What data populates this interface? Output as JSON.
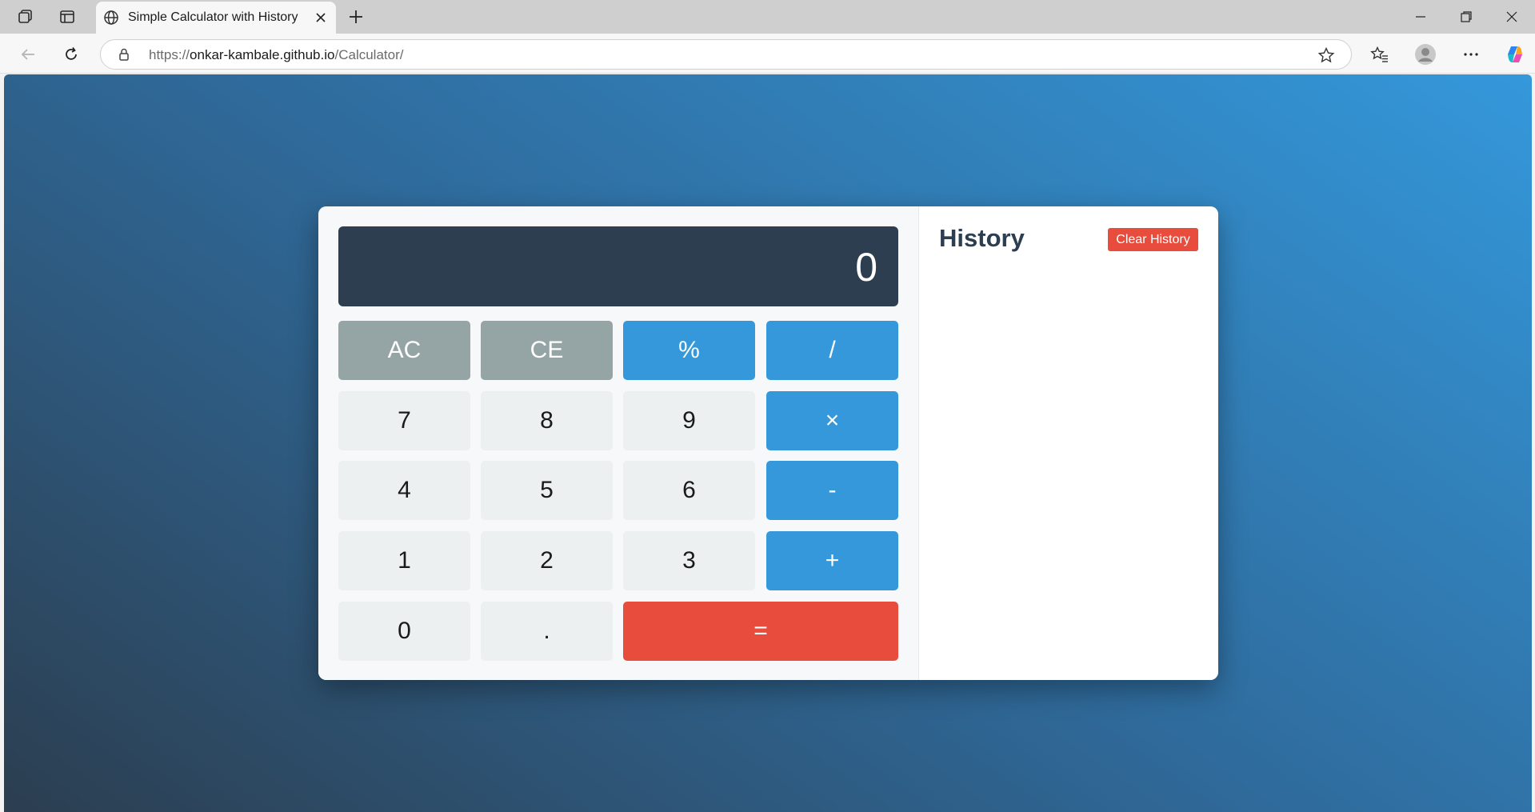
{
  "browser": {
    "tab_title": "Simple Calculator with History",
    "url_prefix": "https://",
    "url_host": "onkar-kambale.github.io",
    "url_path": "/Calculator/"
  },
  "calculator": {
    "display_value": "0",
    "keys": {
      "ac": "AC",
      "ce": "CE",
      "percent": "%",
      "divide": "/",
      "seven": "7",
      "eight": "8",
      "nine": "9",
      "multiply": "×",
      "four": "4",
      "five": "5",
      "six": "6",
      "subtract": "-",
      "one": "1",
      "two": "2",
      "three": "3",
      "add": "+",
      "zero": "0",
      "decimal": ".",
      "equals": "="
    }
  },
  "history": {
    "title": "History",
    "clear_label": "Clear History",
    "items": []
  },
  "colors": {
    "display_bg": "#2c3e50",
    "operator": "#3498db",
    "function": "#95a5a6",
    "equals": "#e74c3c",
    "number": "#ecf0f1"
  }
}
